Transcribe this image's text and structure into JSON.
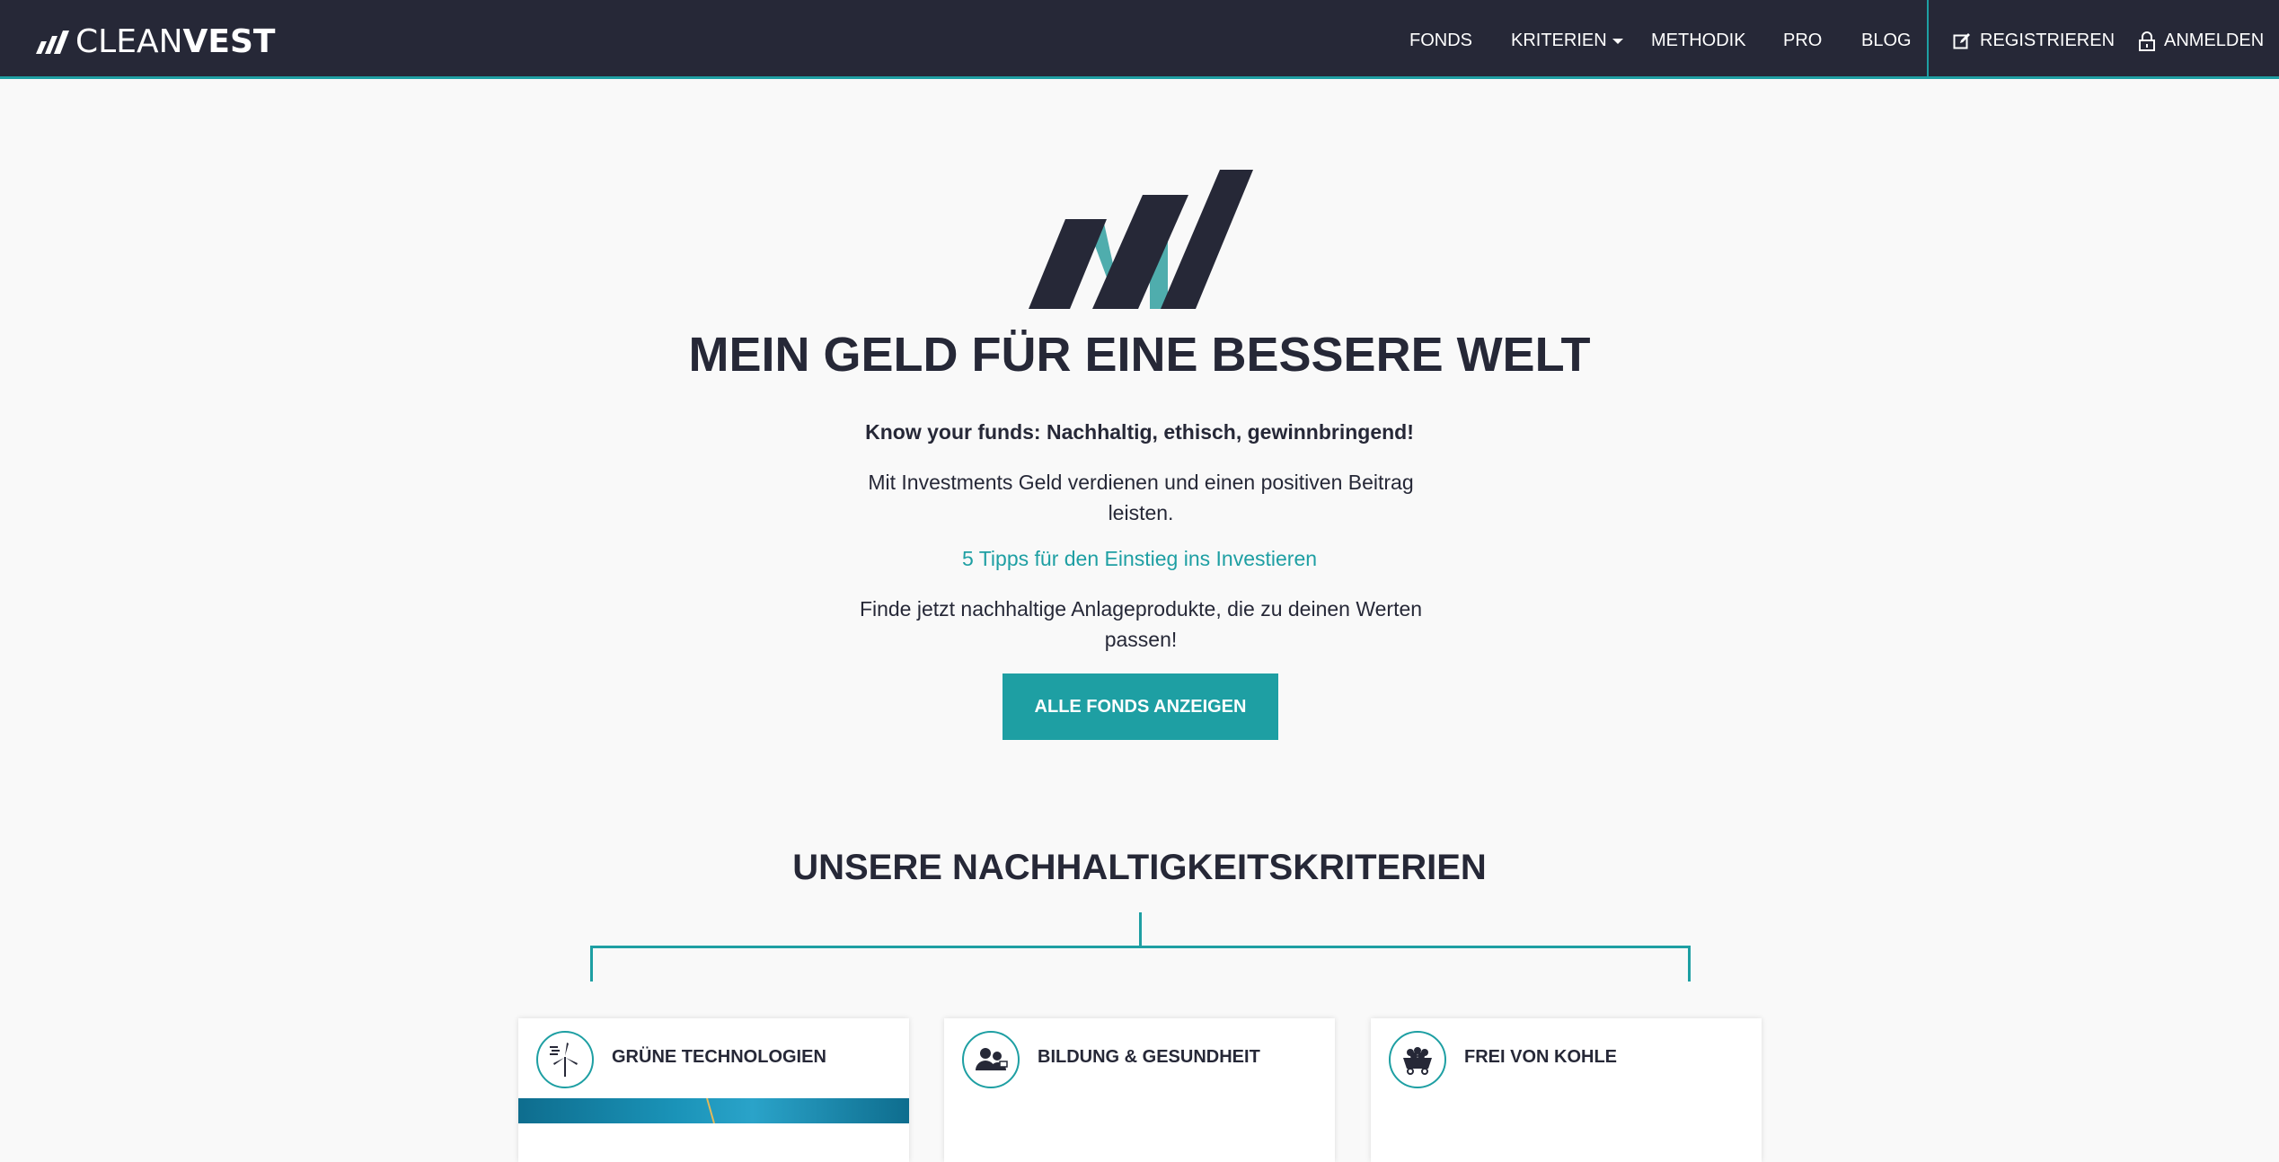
{
  "nav": {
    "brand_light": "CLEAN",
    "brand_bold": "VEST",
    "items": [
      {
        "label": "FONDS"
      },
      {
        "label": "KRITERIEN"
      },
      {
        "label": "METHODIK"
      },
      {
        "label": "PRO"
      },
      {
        "label": "BLOG"
      }
    ],
    "register": "REGISTRIEREN",
    "login": "ANMELDEN"
  },
  "hero": {
    "title": "MEIN GELD FÜR EINE BESSERE WELT",
    "tagline": "Know your funds: Nachhaltig, ethisch, gewinnbringend!",
    "text1": "Mit Investments Geld verdienen und einen positiven Beitrag leisten.",
    "link": "5 Tipps für den Einstieg ins Investieren",
    "text2": "Finde jetzt nachhaltige Anlageprodukte, die zu deinen Werten passen!",
    "cta": "ALLE FONDS ANZEIGEN"
  },
  "criteria": {
    "title": "UNSERE NACHHALTIGKEITSKRITERIEN",
    "cards": [
      {
        "title": "GRÜNE TECHNOLOGIEN",
        "icon": "wind-turbine-icon"
      },
      {
        "title": "BILDUNG & GESUNDHEIT",
        "icon": "people-icon"
      },
      {
        "title": "FREI VON KOHLE",
        "icon": "coal-cart-icon"
      }
    ]
  },
  "colors": {
    "navy": "#262837",
    "teal": "#1e9fa3",
    "background": "#f9f9f9"
  }
}
